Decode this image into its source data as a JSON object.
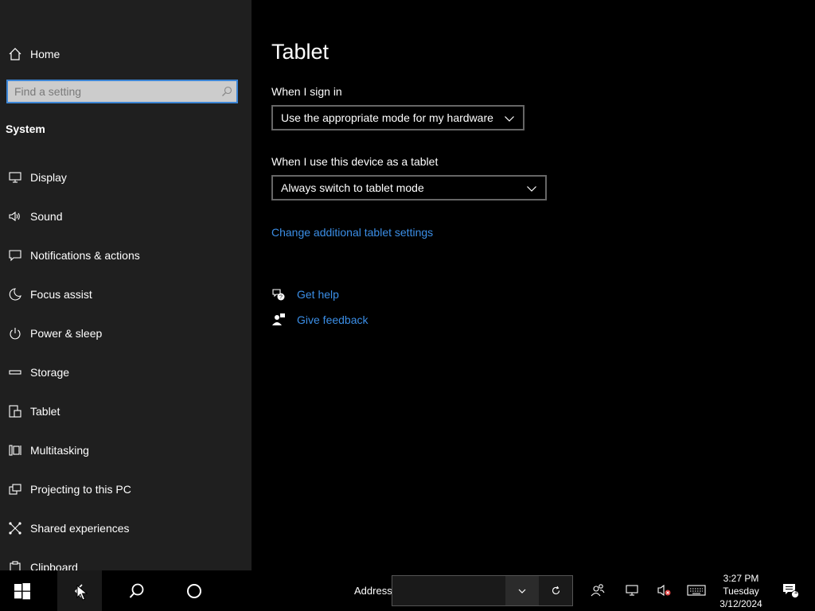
{
  "sidebar": {
    "home_label": "Home",
    "search_placeholder": "Find a setting",
    "section_title": "System",
    "items": [
      {
        "label": "Display",
        "icon": "monitor-icon"
      },
      {
        "label": "Sound",
        "icon": "speaker-icon"
      },
      {
        "label": "Notifications & actions",
        "icon": "message-icon"
      },
      {
        "label": "Focus assist",
        "icon": "moon-icon"
      },
      {
        "label": "Power & sleep",
        "icon": "power-icon"
      },
      {
        "label": "Storage",
        "icon": "storage-icon"
      },
      {
        "label": "Tablet",
        "icon": "tablet-icon"
      },
      {
        "label": "Multitasking",
        "icon": "multitasking-icon"
      },
      {
        "label": "Projecting to this PC",
        "icon": "projecting-icon"
      },
      {
        "label": "Shared experiences",
        "icon": "shared-icon"
      },
      {
        "label": "Clipboard",
        "icon": "clipboard-icon"
      }
    ]
  },
  "main": {
    "title": "Tablet",
    "signin_label": "When I sign in",
    "signin_value": "Use the appropriate mode for my hardware",
    "tablet_label": "When I use this device as a tablet",
    "tablet_value": "Always switch to tablet mode",
    "additional_link": "Change additional tablet settings",
    "get_help": "Get help",
    "give_feedback": "Give feedback"
  },
  "taskbar": {
    "address_label": "Address",
    "address_value": "",
    "clock_time": "3:27 PM",
    "clock_day": "Tuesday",
    "clock_date": "3/12/2024",
    "notification_count": "1"
  },
  "colors": {
    "sidebar_bg": "#1f1f1f",
    "accent": "#3b8ee6",
    "search_border": "#3d86d6"
  }
}
